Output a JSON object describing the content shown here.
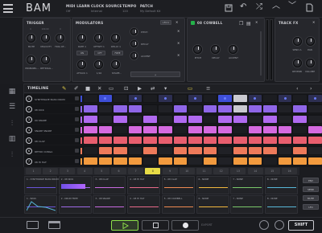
{
  "app": {
    "logo": "BAM"
  },
  "header": {
    "midi_learn_label": "MIDI LEARN",
    "midi_learn_value": "Off",
    "clock_source_label": "CLOCK SOURCE",
    "clock_source_value": "Internal",
    "tempo_label": "TEMPO",
    "tempo_value": "120",
    "patch_label": "PATCH",
    "patch_value": "My Default Kit"
  },
  "trigger": {
    "title": "TRIGGER",
    "mute_label": "MUTE",
    "velocity_label": "VELOCITY",
    "prob_label": "TRIG OF...",
    "probability_label": "PROBABIL...",
    "retrig_label": "RETRIGG...",
    "v1": "0",
    "v2": "100.00",
    "v3": "0"
  },
  "modulators": {
    "title": "MODULATORS",
    "lfo_label": "LFO",
    "rate_label": "RATE 1",
    "offset_label": "OFFSET 1",
    "delay_label": "DELAY 1",
    "pill_on": "ON",
    "pill_off": "OFF",
    "pill_free": "FREE",
    "attack_label": "ATTACK 1",
    "rate_div": "1/16",
    "shape_label": "SHAPE...",
    "pitch_label": "PITCH",
    "decay_label": "DECAY",
    "accent_label": "ACCENT",
    "add_label": "+"
  },
  "instrument": {
    "title": "08 COWBELL",
    "pitch_label": "PITCH",
    "decay_label": "DECAY",
    "accent_label": "ACCENT"
  },
  "track_fx": {
    "title": "TRACK FX",
    "send_label": "SEND A",
    "pan_label": "PAN",
    "reverb_label": "REVERB",
    "volume_label": "VOLUME"
  },
  "timeline": {
    "title": "TIMELINE"
  },
  "tracks": [
    {
      "num": "1",
      "name": "SYNTHWAVE BASS DRUM",
      "color": "#3e4fd8"
    },
    {
      "num": "2",
      "name": "08 KICK",
      "color": "#8f66e8"
    },
    {
      "num": "3",
      "name": "09 SNARE",
      "color": "#b06af0"
    },
    {
      "num": "4",
      "name": "SNARE SNARE",
      "color": "#d56ae0"
    },
    {
      "num": "5",
      "name": "08 CLAP",
      "color": "#e85e6e"
    },
    {
      "num": "6",
      "name": "RETRO CONGA",
      "color": "#ee7a5a"
    },
    {
      "num": "7",
      "name": "08 HI HAT",
      "color": "#f29a3e"
    }
  ],
  "steps": [
    "1",
    "2",
    "3",
    "4",
    "5",
    "6",
    "7",
    "8",
    "9",
    "10",
    "11",
    "12",
    "13",
    "14",
    "15",
    "16"
  ],
  "mixer_rows": [
    [
      "1 - SYNTHWAVE BASS DRUM",
      "2 - 08 KICK",
      "3 - 08 CLAP",
      "4 - 08 HI HAT",
      "5 - 08 CLAP",
      "6 - NONE",
      "7 - NONE",
      "8 - NONE"
    ],
    [
      "1 - BASS",
      "2 - DRUM FREE",
      "3 - 08 SNARE",
      "4 - 08 HI HAT",
      "5 - 08 COWBELL",
      "6 - NONE",
      "7 - NONE",
      "8 - NONE"
    ]
  ],
  "right_buttons": [
    "ENV",
    "SEND",
    "MUTE",
    "LFO"
  ],
  "transport": {
    "export_label": "EXPORT",
    "shift_label": "SHIFT"
  }
}
